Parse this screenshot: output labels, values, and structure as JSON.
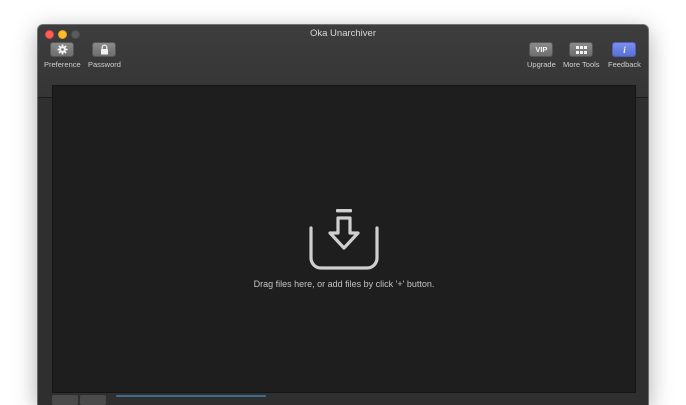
{
  "window": {
    "title": "Oka Unarchiver"
  },
  "toolbar": {
    "left": [
      {
        "label": "Preference",
        "icon": "gear-icon"
      },
      {
        "label": "Password",
        "icon": "lock-icon"
      }
    ],
    "right": [
      {
        "label": "Upgrade",
        "icon": "vip-badge-icon",
        "badge": "VIP"
      },
      {
        "label": "More Tools",
        "icon": "grid-icon"
      },
      {
        "label": "Feedback",
        "icon": "info-icon",
        "badge": "i"
      }
    ]
  },
  "dropzone": {
    "icon": "tray-download-icon",
    "hint": "Drag files here, or add files by click '+' button."
  },
  "colors": {
    "window_bg": "#2f2f2f",
    "dropzone_bg": "#1e1e1e",
    "feedback_accent": "#6a80e0",
    "close": "#fe5f57",
    "minimize": "#febc2e"
  }
}
